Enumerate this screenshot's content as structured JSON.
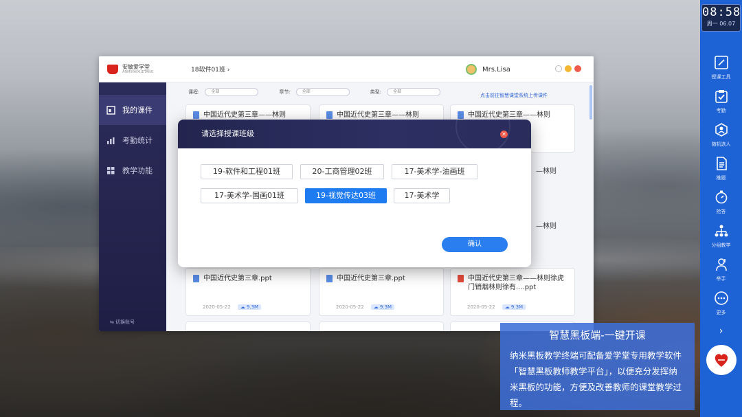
{
  "dock": {
    "time": "08:58",
    "date": "周一 06.07",
    "items": [
      {
        "label": "授课工具",
        "icon": "pen-icon"
      },
      {
        "label": "考勤",
        "icon": "clipboard-check-icon"
      },
      {
        "label": "随机选人",
        "icon": "random-person-icon"
      },
      {
        "label": "推题",
        "icon": "document-icon"
      },
      {
        "label": "抢答",
        "icon": "stopwatch-icon"
      },
      {
        "label": "分组教学",
        "icon": "group-tree-icon"
      },
      {
        "label": "举手",
        "icon": "raise-hand-icon"
      },
      {
        "label": "更多",
        "icon": "more-dots-icon"
      }
    ],
    "chevron": "›"
  },
  "window": {
    "logo_name": "安敏爱学堂",
    "logo_sub": "ANMINAIXUETANG",
    "course_selector": "18软件01班  ›",
    "user_name": "Mrs.Lisa",
    "sidebar": [
      {
        "label": "我的课件",
        "active": true
      },
      {
        "label": "考勤统计",
        "active": false
      },
      {
        "label": "教学功能",
        "active": false
      }
    ],
    "switch_account": "切换账号",
    "filters": [
      {
        "label": "课程:",
        "value": "全部"
      },
      {
        "label": "章节:",
        "value": "全部"
      },
      {
        "label": "类型:",
        "value": "全部"
      }
    ],
    "upload_link": "点击前往智慧课堂系统上传课件",
    "cards": [
      {
        "title": "中国近代史第三章——林则",
        "type": "doc"
      },
      {
        "title": "中国近代史第三章——林则",
        "type": "doc"
      },
      {
        "title": "中国近代史第三章——林则",
        "type": "doc"
      },
      {
        "title": "中国近代史第三章.ppt",
        "type": "doc",
        "date": "2020-05-22",
        "size": "9.3M"
      },
      {
        "title": "中国近代史第三章.ppt",
        "type": "doc",
        "date": "2020-05-22",
        "size": "9.3M"
      },
      {
        "title": "中国近代史第三章——林则徐虎门销烟林则徐有....ppt",
        "type": "pdf",
        "date": "2020-05-22",
        "size": "9.3M"
      }
    ],
    "peek_right": [
      "—林则",
      "—林则",
      "—林则",
      "有....ppt"
    ]
  },
  "modal": {
    "title": "请选择授课班级",
    "classes": [
      {
        "label": "19-软件和工程01班",
        "selected": false
      },
      {
        "label": "20-工商管理02班",
        "selected": false
      },
      {
        "label": "17-美术学-油画班",
        "selected": false
      },
      {
        "label": "17-美术学-国画01班",
        "selected": false
      },
      {
        "label": "19-视觉传达03班",
        "selected": true
      },
      {
        "label": "17-美术学",
        "selected": false
      }
    ],
    "confirm_label": "确认"
  },
  "info": {
    "title": "智慧黑板端-一键开课",
    "body": "纳米黑板教学终端可配备爱学堂专用教学软件「智慧黑板教师教学平台」，以便充分发挥纳米黑板的功能，方便及改善教师的课堂教学过程。"
  },
  "colors": {
    "dock": "#1e63d6",
    "sidebar": "#2c2c5a",
    "modal_header": "#23254f",
    "selected": "#1f7bf0",
    "close": "#f15a4a"
  }
}
